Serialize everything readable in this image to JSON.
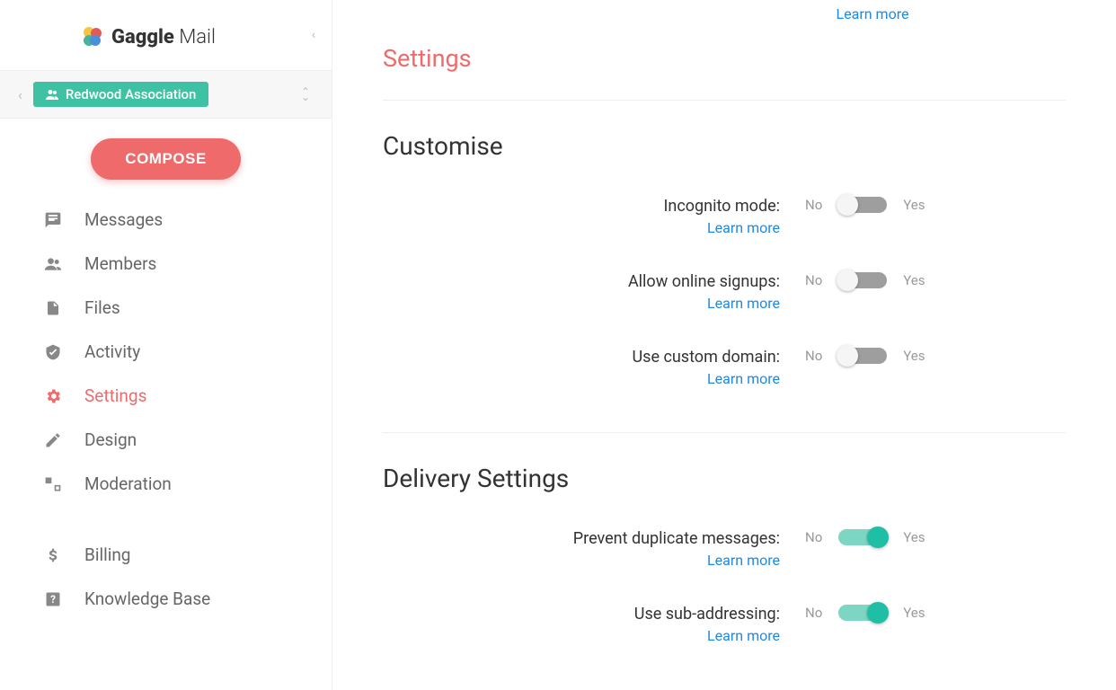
{
  "brand": {
    "name_bold": "Gaggle",
    "name_light": " Mail"
  },
  "org": {
    "name": "Redwood Association"
  },
  "compose": {
    "label": "COMPOSE"
  },
  "nav": {
    "messages": "Messages",
    "members": "Members",
    "files": "Files",
    "activity": "Activity",
    "settings": "Settings",
    "design": "Design",
    "moderation": "Moderation",
    "billing": "Billing",
    "knowledge_base": "Knowledge Base"
  },
  "page": {
    "top_learn": "Learn more",
    "title": "Settings",
    "learn_more_label": "Learn more",
    "no_label": "No",
    "yes_label": "Yes"
  },
  "sections": {
    "customise": {
      "title": "Customise",
      "incognito": {
        "label": "Incognito mode:",
        "on": false
      },
      "signups": {
        "label": "Allow online signups:",
        "on": false
      },
      "domain": {
        "label": "Use custom domain:",
        "on": false
      }
    },
    "delivery": {
      "title": "Delivery Settings",
      "dup": {
        "label": "Prevent duplicate messages:",
        "on": true
      },
      "sub": {
        "label": "Use sub-addressing:",
        "on": true
      }
    }
  }
}
